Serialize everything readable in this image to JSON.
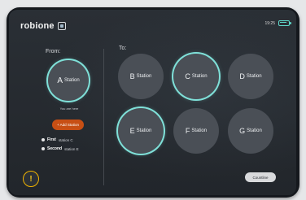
{
  "header": {
    "logo": "robione",
    "time": "19:25"
  },
  "from": {
    "label": "From:",
    "station": {
      "letter": "A",
      "word": "Station"
    },
    "you_are_here": "You are here",
    "add_station": "+ Add Station"
  },
  "legend": [
    {
      "bold": "First",
      "rest": "station C"
    },
    {
      "bold": "Second",
      "rest": "station E"
    }
  ],
  "to": {
    "label": "To:",
    "stations": [
      {
        "letter": "B",
        "word": "Station",
        "selected": false
      },
      {
        "letter": "C",
        "word": "Station",
        "selected": true
      },
      {
        "letter": "D",
        "word": "Station",
        "selected": false
      },
      {
        "letter": "E",
        "word": "Station",
        "selected": true
      },
      {
        "letter": "F",
        "word": "Station",
        "selected": false
      },
      {
        "letter": "G",
        "word": "Station",
        "selected": false
      }
    ]
  },
  "buttons": {
    "info": "!",
    "countline": "Countline"
  },
  "colors": {
    "accent_ring": "#7fe0d8",
    "add_button": "#c74f14",
    "info_ring": "#f0b300"
  }
}
